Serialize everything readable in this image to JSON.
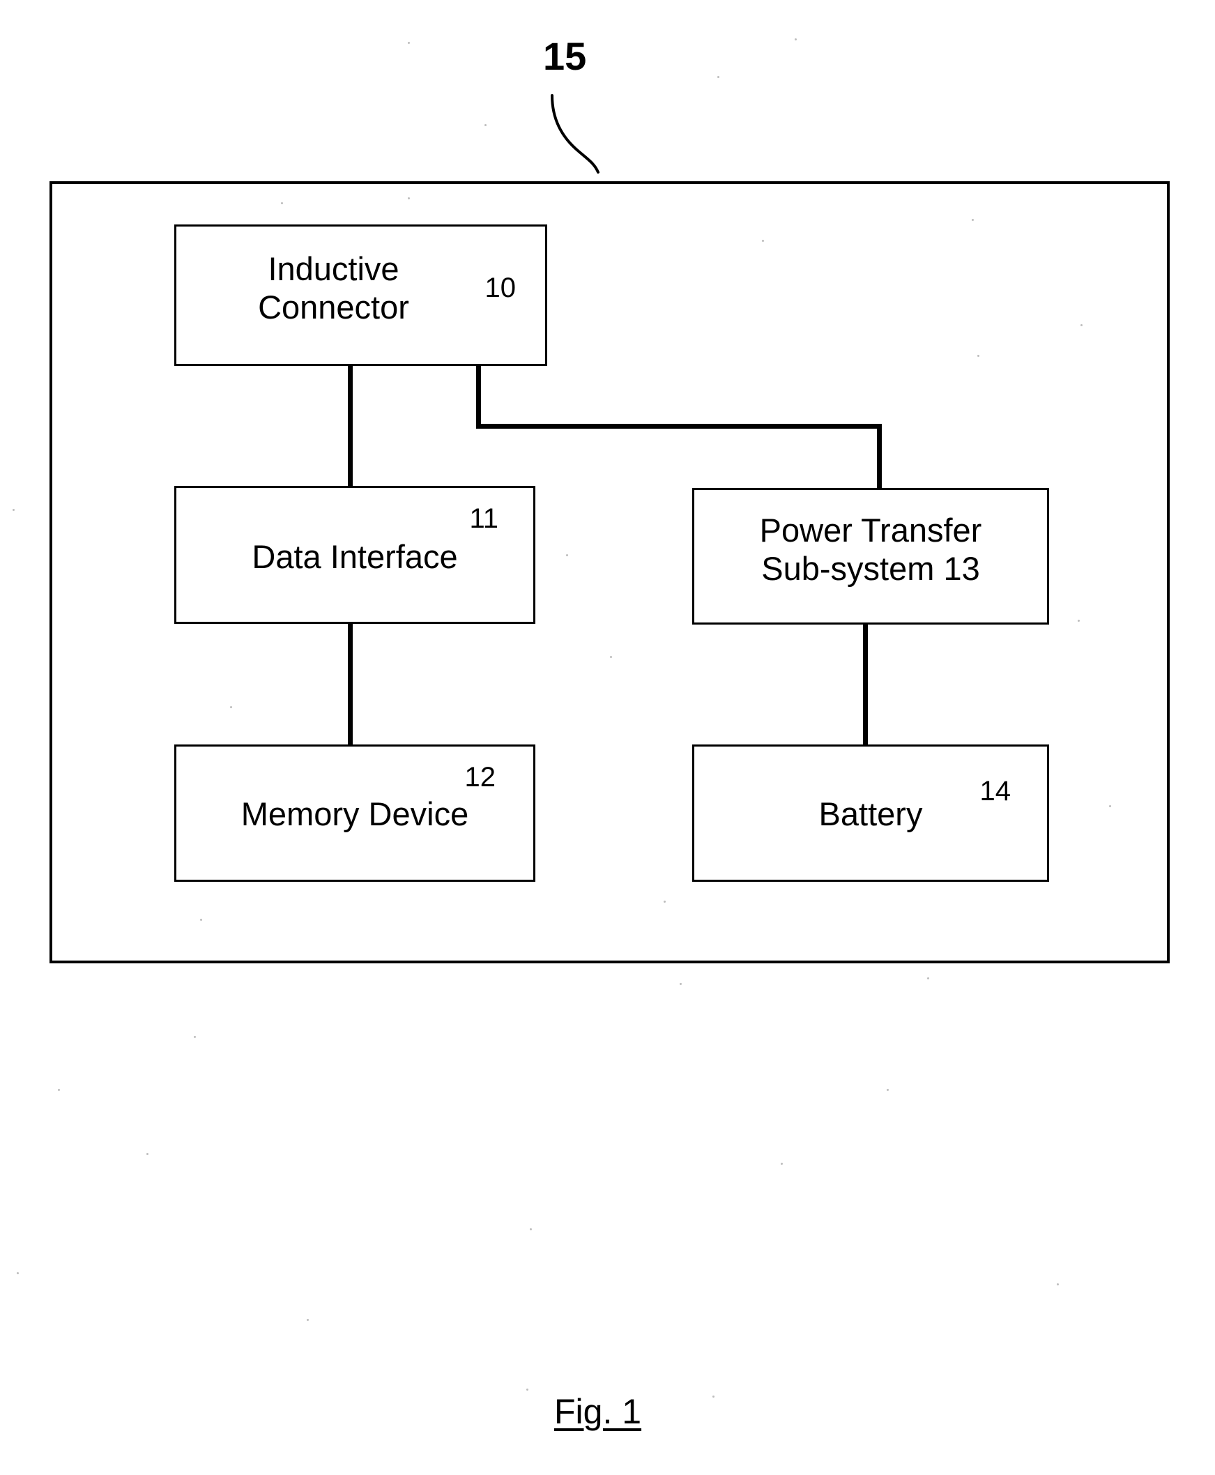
{
  "figure": {
    "caption": "Fig. 1",
    "system_ref": "15"
  },
  "diagram_data": {
    "type": "block-diagram",
    "title": "Fig. 1",
    "system_label": "15",
    "nodes": [
      {
        "id": "inductive-connector",
        "label": "Inductive\nConnector",
        "ref": "10"
      },
      {
        "id": "data-interface",
        "label": "Data Interface",
        "ref": "11"
      },
      {
        "id": "memory-device",
        "label": "Memory Device",
        "ref": "12"
      },
      {
        "id": "power-transfer",
        "label": "Power Transfer\nSub-system 13",
        "ref": "13"
      },
      {
        "id": "battery",
        "label": "Battery",
        "ref": "14"
      }
    ],
    "edges": [
      {
        "from": "inductive-connector",
        "to": "data-interface"
      },
      {
        "from": "data-interface",
        "to": "memory-device"
      },
      {
        "from": "inductive-connector",
        "to": "power-transfer"
      },
      {
        "from": "power-transfer",
        "to": "battery"
      }
    ]
  },
  "blocks": {
    "inductive_connector": {
      "label": "Inductive\nConnector",
      "ref": "10"
    },
    "data_interface": {
      "label": "Data Interface",
      "ref": "11"
    },
    "memory_device": {
      "label": "Memory Device",
      "ref": "12"
    },
    "power_transfer": {
      "label": "Power Transfer\nSub-system 13"
    },
    "battery": {
      "label": "Battery",
      "ref": "14"
    }
  },
  "colors": {
    "line": "#000000",
    "background": "#ffffff"
  }
}
